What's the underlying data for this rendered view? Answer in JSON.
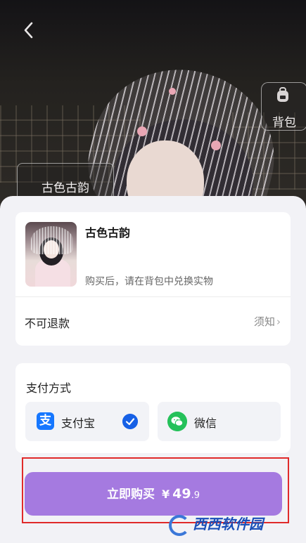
{
  "header": {
    "backpack_label": "背包",
    "product_chip": "古色古韵"
  },
  "product": {
    "name": "古色古韵",
    "description": "购买后，请在背包中兑换实物",
    "refund_policy": "不可退款",
    "notice_link": "须知"
  },
  "payment": {
    "title": "支付方式",
    "options": [
      {
        "label": "支付宝",
        "icon": "alipay-icon",
        "selected": true
      },
      {
        "label": "微信",
        "icon": "wechat-icon",
        "selected": false
      }
    ]
  },
  "purchase": {
    "label": "立即购买",
    "currency": "¥",
    "price_int": "49",
    "price_dec": ".9"
  },
  "watermark": "西西软件园",
  "colors": {
    "button": "#a57ae0",
    "highlight_frame": "#e02a2a",
    "alipay": "#1677ff",
    "wechat": "#25c15a",
    "check": "#1660e6"
  }
}
